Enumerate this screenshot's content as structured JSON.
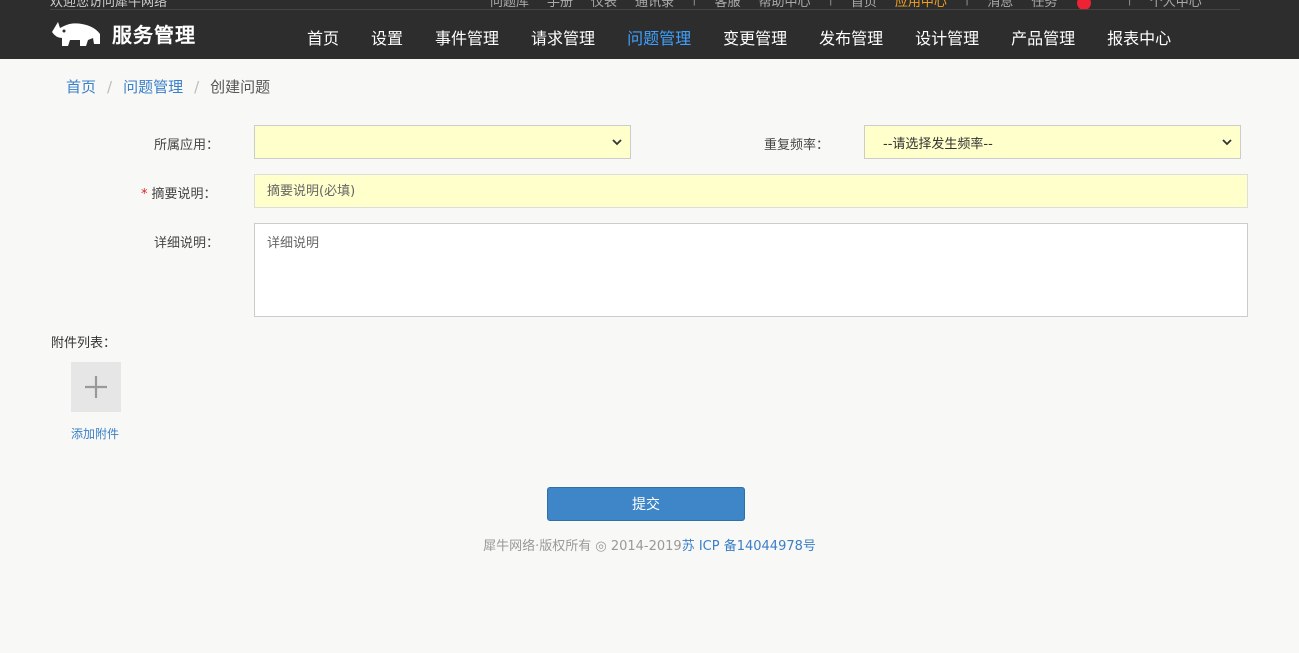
{
  "header": {
    "welcome_text": "欢迎您访问犀牛网络",
    "top_links": [
      "问题库",
      "手册",
      "仪表",
      "通讯录"
    ],
    "top_links_2": [
      "客服",
      "帮助中心"
    ],
    "top_links_3": [
      "首页",
      "应用中心"
    ],
    "top_links_4": [
      "消息",
      "任务"
    ],
    "top_links_5": "个人中心",
    "logo_text": "服务管理",
    "nav": [
      {
        "label": "首页",
        "active": false
      },
      {
        "label": "设置",
        "active": false
      },
      {
        "label": "事件管理",
        "active": false
      },
      {
        "label": "请求管理",
        "active": false
      },
      {
        "label": "问题管理",
        "active": true
      },
      {
        "label": "变更管理",
        "active": false
      },
      {
        "label": "发布管理",
        "active": false
      },
      {
        "label": "设计管理",
        "active": false
      },
      {
        "label": "产品管理",
        "active": false
      },
      {
        "label": "报表中心",
        "active": false
      }
    ],
    "accent_color": "#3ea1ff"
  },
  "breadcrumb": {
    "home": "首页",
    "parent": "问题管理",
    "current": "创建问题",
    "separator": "/"
  },
  "form": {
    "app_label": "所属应用：",
    "app_value": "",
    "frequency_label": "重复频率：",
    "frequency_value": "--请选择发生频率--",
    "summary_required_mark": "*",
    "summary_label": "摘要说明：",
    "summary_placeholder": "摘要说明(必填)",
    "detail_label": "详细说明：",
    "detail_placeholder": "详细说明"
  },
  "attachments": {
    "title": "附件列表：",
    "add_label": "添加附件"
  },
  "submit_label": "提交",
  "footer": {
    "copyright": "犀牛网络·版权所有 ◎ 2014-2019",
    "icp": "苏 ICP 备14044978号"
  }
}
